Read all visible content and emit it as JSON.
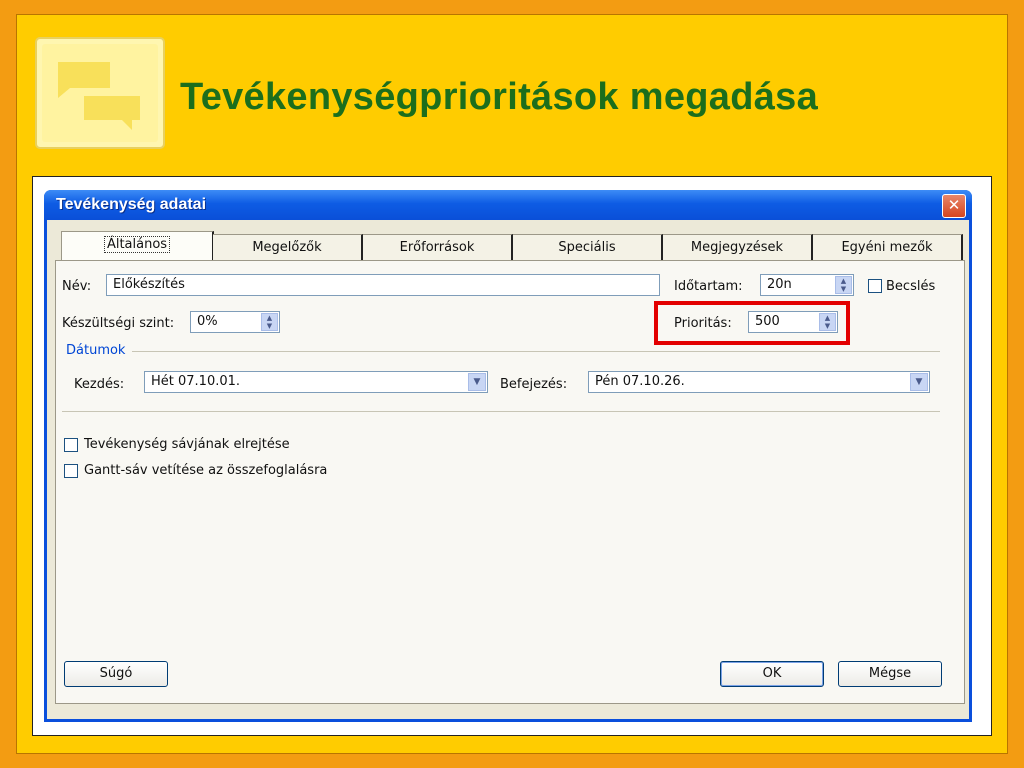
{
  "slide": {
    "title": "Tevékenységprioritások megadása",
    "logo_icon": "speech-bubbles-icon"
  },
  "dialog": {
    "title": "Tevékenység adatai",
    "close_glyph": "✕",
    "tabs": [
      {
        "label": "Általános"
      },
      {
        "label": "Megelőzők"
      },
      {
        "label": "Erőforrások"
      },
      {
        "label": "Speciális"
      },
      {
        "label": "Megjegyzések"
      },
      {
        "label": "Egyéni mezők"
      }
    ],
    "name_label": "Név:",
    "name_value": "Előkészítés",
    "duration_label": "Időtartam:",
    "duration_value": "20n",
    "estimate_label": "Becslés",
    "complete_label": "Készültségi szint:",
    "complete_value": "0%",
    "priority_label": "Prioritás:",
    "priority_value": "500",
    "dates_group": "Dátumok",
    "start_label": "Kezdés:",
    "start_value": "Hét 07.10.01.",
    "finish_label": "Befejezés:",
    "finish_value": "Pén 07.10.26.",
    "hide_bar_label": "Tevékenység sávjának elrejtése",
    "rollup_label": "Gantt-sáv vetítése az összefoglalásra",
    "help_button": "Súgó",
    "ok_button": "OK",
    "cancel_button": "Mégse"
  },
  "colors": {
    "title": "#1c6e1c",
    "slide_bg": "#ffcc00",
    "frame": "#f39c12",
    "highlight": "#e30000",
    "titlebar": "#0a4fdc"
  }
}
